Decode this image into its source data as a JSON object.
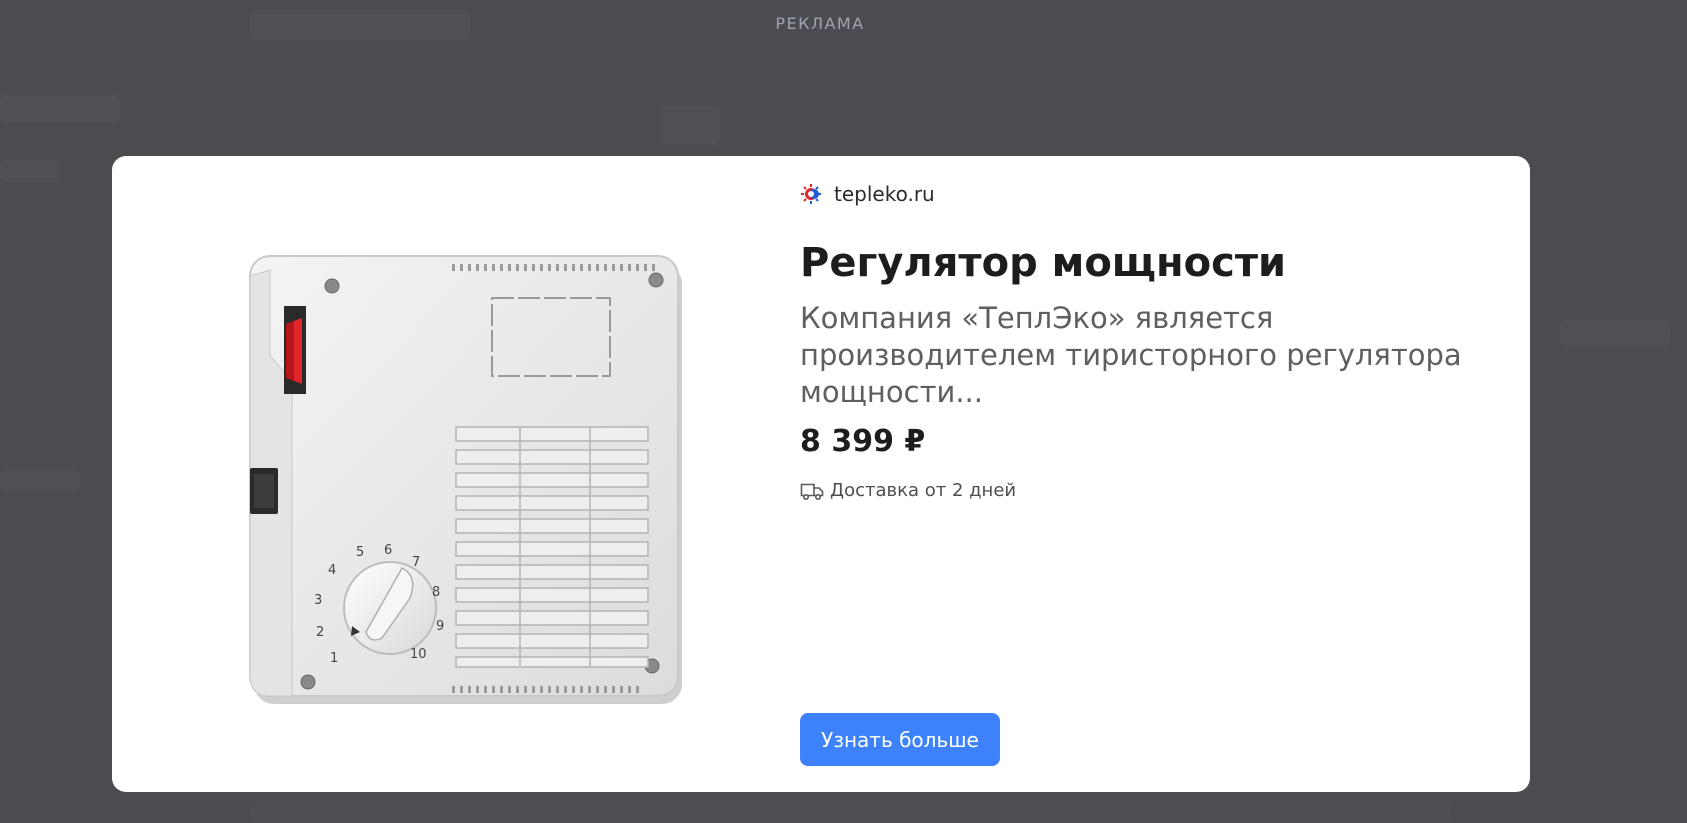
{
  "ad_label": "РЕКЛАМА",
  "ad": {
    "domain": "tepleko.ru",
    "title": "Регулятор мощности",
    "description": "Компания «ТеплЭко» является производителем тиристорного регулятора мощности...",
    "price": "8 399 ₽",
    "delivery": "Доставка от 2 дней",
    "cta_label": "Узнать больше"
  },
  "product_image": {
    "dial_labels": [
      "1",
      "2",
      "3",
      "4",
      "5",
      "6",
      "7",
      "8",
      "9",
      "10"
    ]
  },
  "icons": {
    "favicon": "tepleko-logo-icon",
    "delivery": "truck-icon"
  },
  "colors": {
    "overlay": "#4b4c4f",
    "card": "#ffffff",
    "button": "#3d82fa",
    "button_text": "#ffffff",
    "title": "#1d1d1f",
    "description": "#5f5f63",
    "ad_label": "#9ea3b0",
    "switch_red": "#e0262b"
  }
}
